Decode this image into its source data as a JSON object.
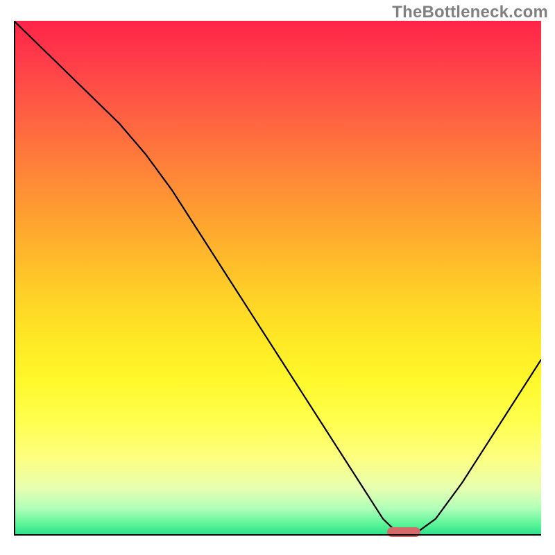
{
  "watermark": "TheBottleneck.com",
  "chart_data": {
    "type": "line",
    "title": "",
    "xlabel": "",
    "ylabel": "",
    "xlim": [
      0,
      100
    ],
    "ylim": [
      0,
      100
    ],
    "x": [
      0,
      5,
      10,
      15,
      20,
      25,
      30,
      35,
      40,
      45,
      50,
      55,
      60,
      65,
      70,
      73,
      76,
      80,
      85,
      90,
      95,
      100
    ],
    "values": [
      100,
      95,
      90,
      85,
      80,
      74,
      67,
      59,
      51,
      43,
      35,
      27,
      19,
      11,
      3,
      0,
      0,
      3,
      10,
      18,
      26,
      34
    ],
    "marker_x": 74,
    "marker_y": 0,
    "legend": null,
    "grid": false
  },
  "colors": {
    "curve": "#000000",
    "marker": "#d46a6a"
  }
}
